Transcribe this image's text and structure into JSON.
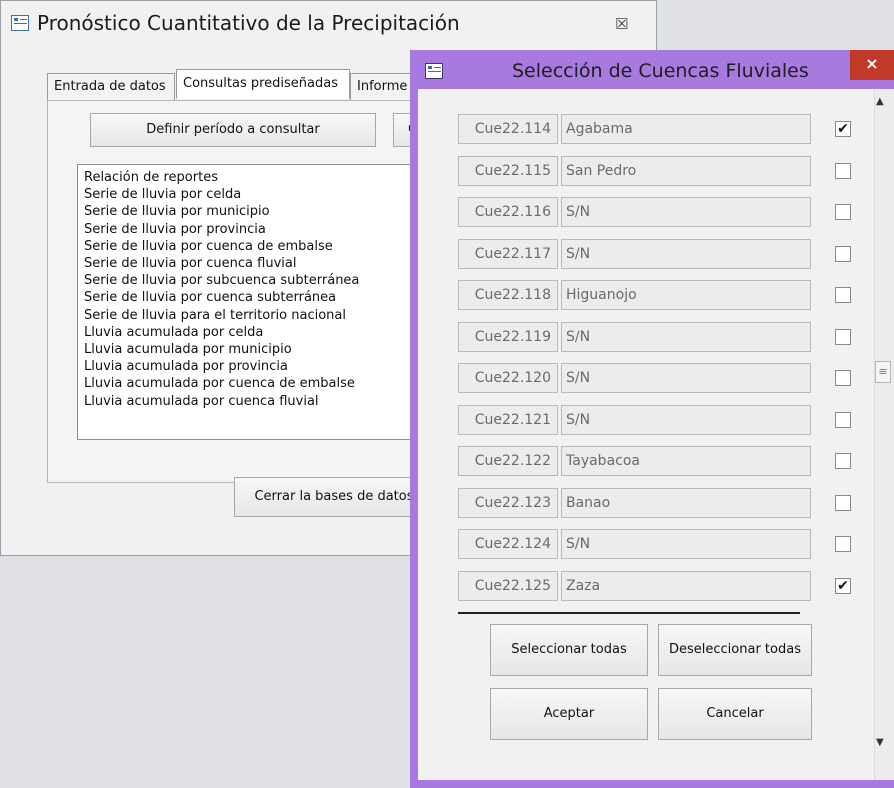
{
  "main_window": {
    "title": "Pronóstico Cuantitativo de la Precipitación",
    "close_glyph": "☒",
    "tabs": [
      "Entrada de datos",
      "Consultas prediseñadas",
      "Informe"
    ],
    "define_period_button": "Definir período a consultar",
    "partial_button": "C",
    "list_items": [
      "Relación de reportes",
      "Serie de lluvia por celda",
      "Serie de lluvia por municipio",
      "Serie de lluvia por provincia",
      "Serie de lluvia por cuenca de embalse",
      "Serie de lluvia por cuenca fluvial",
      "Serie de lluvia por subcuenca subterránea",
      "Serie de lluvia por cuenca subterránea",
      "Serie de lluvia para el territorio nacional",
      "Lluvia acumulada por celda",
      "Lluvia acumulada por municipio",
      "Lluvia acumulada por provincia",
      "Lluvia acumulada por cuenca de embalse",
      "Lluvia acumulada por cuenca fluvial"
    ],
    "close_db_button": "Cerrar la bases de datos"
  },
  "dialog": {
    "title": "Selección de Cuencas Fluviales",
    "close_glyph": "×",
    "rows": [
      {
        "code": "Cue22.114",
        "name": "Agabama",
        "checked": true
      },
      {
        "code": "Cue22.115",
        "name": "San Pedro",
        "checked": false
      },
      {
        "code": "Cue22.116",
        "name": "S/N",
        "checked": false
      },
      {
        "code": "Cue22.117",
        "name": "S/N",
        "checked": false
      },
      {
        "code": "Cue22.118",
        "name": "Higuanojo",
        "checked": false
      },
      {
        "code": "Cue22.119",
        "name": "S/N",
        "checked": false
      },
      {
        "code": "Cue22.120",
        "name": "S/N",
        "checked": false
      },
      {
        "code": "Cue22.121",
        "name": "S/N",
        "checked": false
      },
      {
        "code": "Cue22.122",
        "name": "Tayabacoa",
        "checked": false
      },
      {
        "code": "Cue22.123",
        "name": "Banao",
        "checked": false
      },
      {
        "code": "Cue22.124",
        "name": "S/N",
        "checked": false
      },
      {
        "code": "Cue22.125",
        "name": "Zaza",
        "checked": true
      }
    ],
    "select_all": "Seleccionar todas",
    "deselect_all": "Deseleccionar todas",
    "accept": "Aceptar",
    "cancel": "Cancelar",
    "checkmark_glyph": "✔",
    "scroll_up_glyph": "▲",
    "scroll_down_glyph": "▼",
    "scroll_thumb_glyph": "≡"
  },
  "colors": {
    "dialog_frame": "#a87adf",
    "close_button": "#c0392b"
  }
}
